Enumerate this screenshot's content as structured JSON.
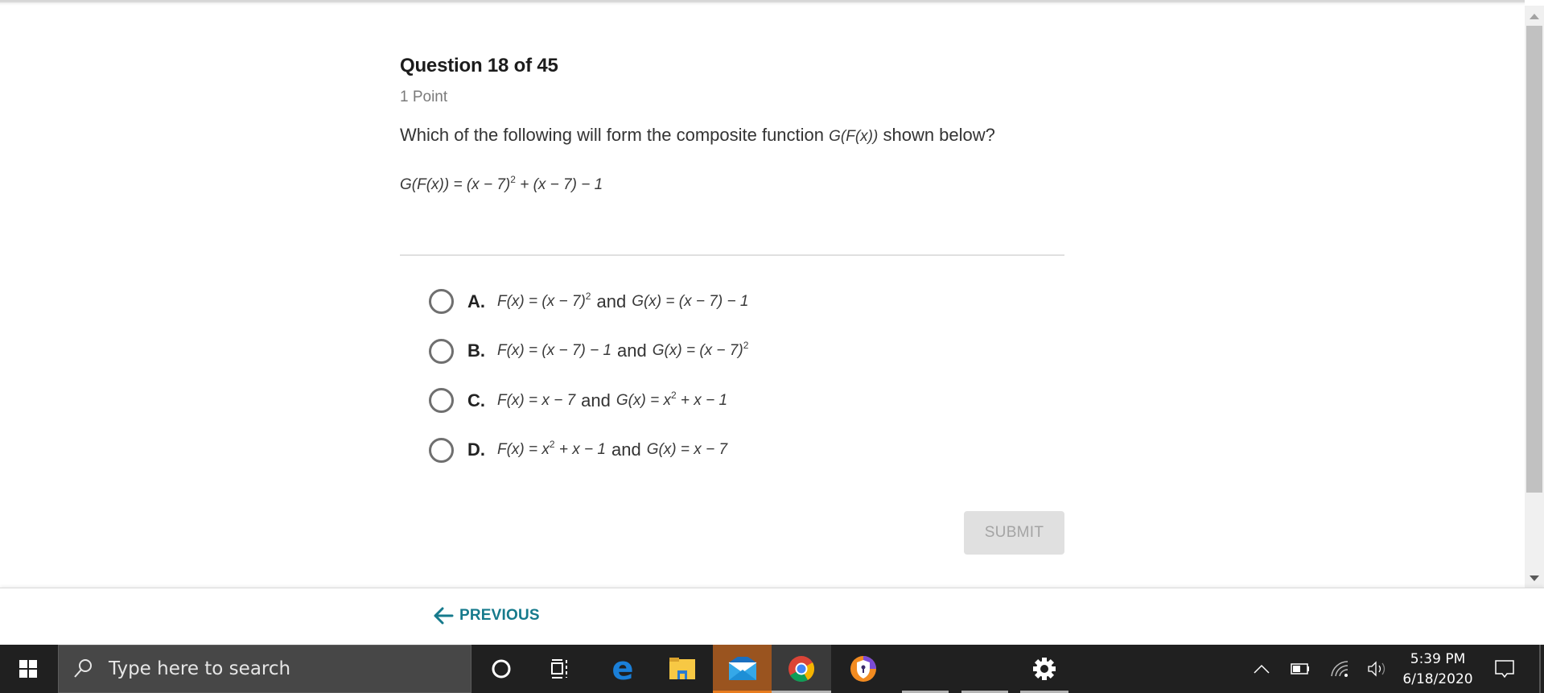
{
  "question": {
    "title": "Question 18 of 45",
    "points": "1 Point",
    "prompt_before": "Which of the following will form the composite function",
    "prompt_math": "G(F(x))",
    "prompt_after": "shown below?",
    "formula": {
      "lhs": "G(F(x)) =",
      "part1": "(x − 7)",
      "exp1": "2",
      "part2": "+ (x − 7) − 1"
    }
  },
  "options": [
    {
      "letter": "A.",
      "f_main": "F(x) = (x − 7)",
      "f_sup": "2",
      "f_tail": "",
      "and": "and",
      "g_main": "G(x) = (x − 7) − 1",
      "g_sup": "",
      "g_tail": ""
    },
    {
      "letter": "B.",
      "f_main": "F(x) = (x − 7) − 1",
      "f_sup": "",
      "f_tail": "",
      "and": "and",
      "g_main": "G(x) = (x − 7)",
      "g_sup": "2",
      "g_tail": ""
    },
    {
      "letter": "C.",
      "f_main": "F(x) = x − 7",
      "f_sup": "",
      "f_tail": "",
      "and": "and",
      "g_main": "G(x) = x",
      "g_sup": "2",
      "g_tail": " + x − 1"
    },
    {
      "letter": "D.",
      "f_main": "F(x) = x",
      "f_sup": "2",
      "f_tail": " + x − 1",
      "and": "and",
      "g_main": "G(x) = x − 7",
      "g_sup": "",
      "g_tail": ""
    }
  ],
  "submit_label": "SUBMIT",
  "previous_label": "PREVIOUS",
  "colors": {
    "accent": "#167a8c",
    "submit_disabled_bg": "#e0e0e0",
    "taskbar_bg": "#202020"
  },
  "taskbar": {
    "search_placeholder": "Type here to search",
    "apps": [
      "cortana-icon",
      "task-view-icon",
      "edge-icon",
      "file-explorer-icon",
      "mail-icon",
      "chrome-icon",
      "avast-secure-browser-icon",
      "settings-icon"
    ],
    "time": "5:39 PM",
    "date": "6/18/2020"
  }
}
